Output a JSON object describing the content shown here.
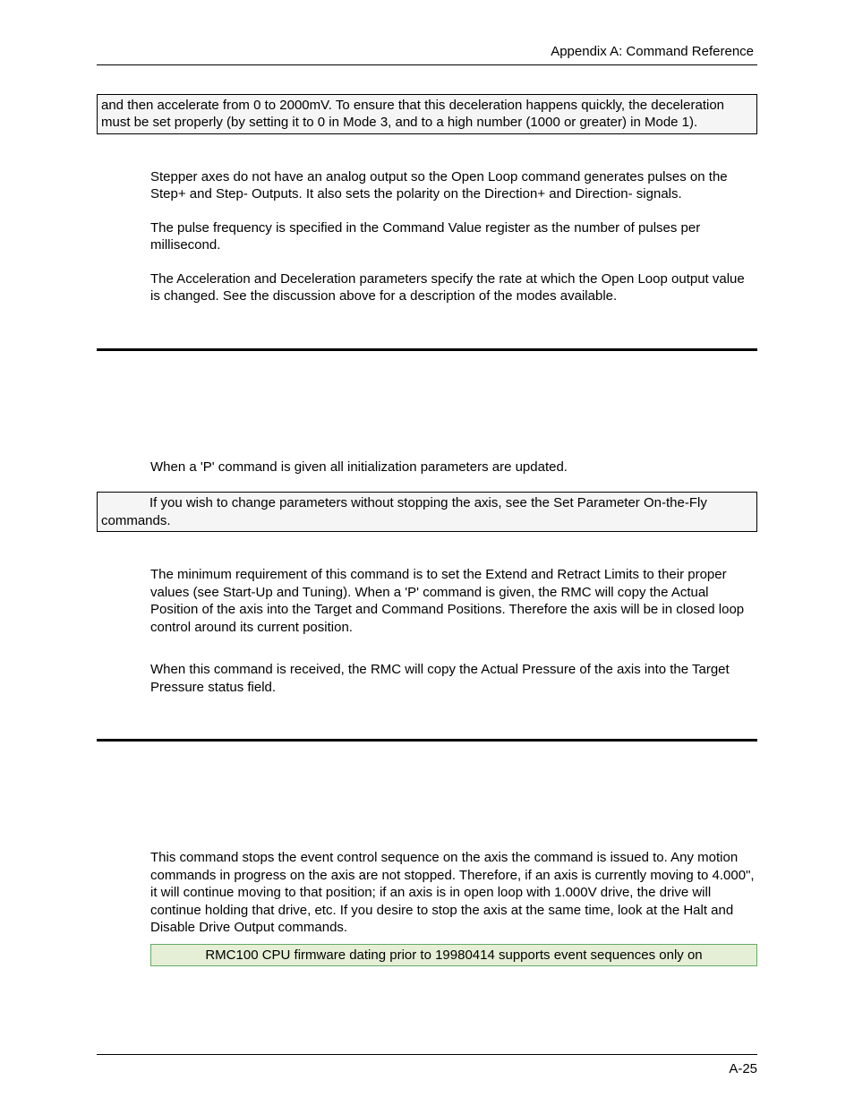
{
  "header": {
    "title": "Appendix A:  Command Reference"
  },
  "box1": "and then accelerate from 0 to 2000mV. To ensure that this deceleration happens quickly, the deceleration must be set properly (by setting it to 0 in Mode 3, and to a high number (1000 or greater) in Mode 1).",
  "para_stepper": "Stepper axes do not have an analog output so the Open Loop command generates pulses on the Step+ and Step- Outputs. It also sets the polarity on the Direction+ and Direction- signals.",
  "para_pulse": "The pulse frequency is specified in the Command Value register as the number of pulses per millisecond.",
  "para_accel": "The Acceleration and Deceleration parameters specify the rate at which the Open Loop output value is changed. See the discussion above for a description of the modes available.",
  "para_pcmd": "When a 'P' command is given all initialization parameters are updated.",
  "box2": "If you wish to change parameters without stopping the axis, see the Set Parameter On-the-Fly commands.",
  "para_minreq": "The minimum requirement of this command is to set the Extend and Retract Limits to their proper values (see Start-Up and Tuning). When a 'P' command is given, the RMC will copy the Actual Position of the axis into the Target and Command Positions. Therefore the axis will be in closed loop control around its current position.",
  "para_pressure": "When this command is received, the RMC will copy the Actual Pressure of the axis into the Target Pressure status field.",
  "para_stopseq": "This command stops the event control sequence on the axis the command is issued to. Any motion commands in progress on the axis are not stopped. Therefore, if an axis is currently moving to 4.000\", it will continue moving to that position; if an axis is in open loop with 1.000V drive, the drive will continue holding that drive, etc. If you desire to stop the axis at the same time, look at the Halt and Disable Drive Output commands.",
  "note": "RMC100 CPU firmware dating prior to 19980414 supports event sequences only on",
  "footer": {
    "page_number": "A-25"
  }
}
